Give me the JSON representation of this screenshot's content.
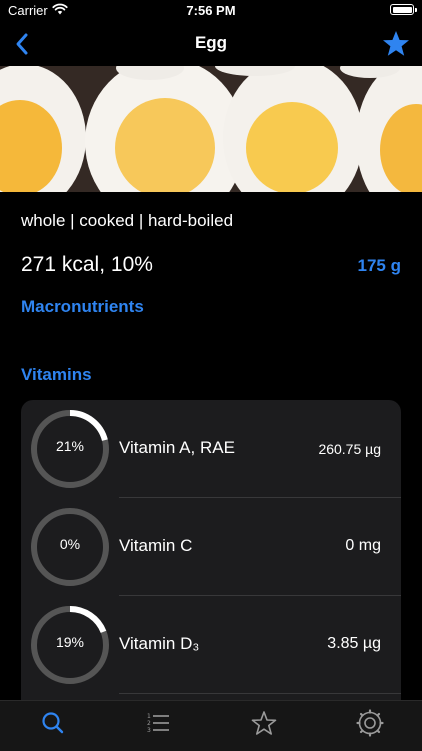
{
  "status_bar": {
    "carrier": "Carrier",
    "time": "7:56 PM"
  },
  "nav": {
    "title": "Egg",
    "icons": [
      "chevron-left-icon",
      "star-icon"
    ]
  },
  "food": {
    "description": "whole | cooked | hard-boiled",
    "energy": "271 kcal, 10%",
    "amount": "175 g"
  },
  "sections": {
    "macronutrients": "Macronutrients",
    "vitamins": "Vitamins"
  },
  "vitamins": [
    {
      "percent_label": "21%",
      "percent": 21,
      "name": "Vitamin A, RAE",
      "value": "260.75 µg"
    },
    {
      "percent_label": "0%",
      "percent": 0,
      "name": "Vitamin C",
      "value": "0 mg"
    },
    {
      "percent_label": "19%",
      "percent": 19,
      "name": "Vitamin D₃",
      "value": "3.85 µg"
    }
  ],
  "tab_bar": {
    "items": [
      "search-icon",
      "list-icon",
      "favorites-icon",
      "settings-icon"
    ],
    "active": "search-icon"
  },
  "colors": {
    "accent": "#2f84f0",
    "background": "#000000",
    "card": "#1c1c1e",
    "ring_track": "#555555",
    "ring_progress": "#ffffff"
  }
}
